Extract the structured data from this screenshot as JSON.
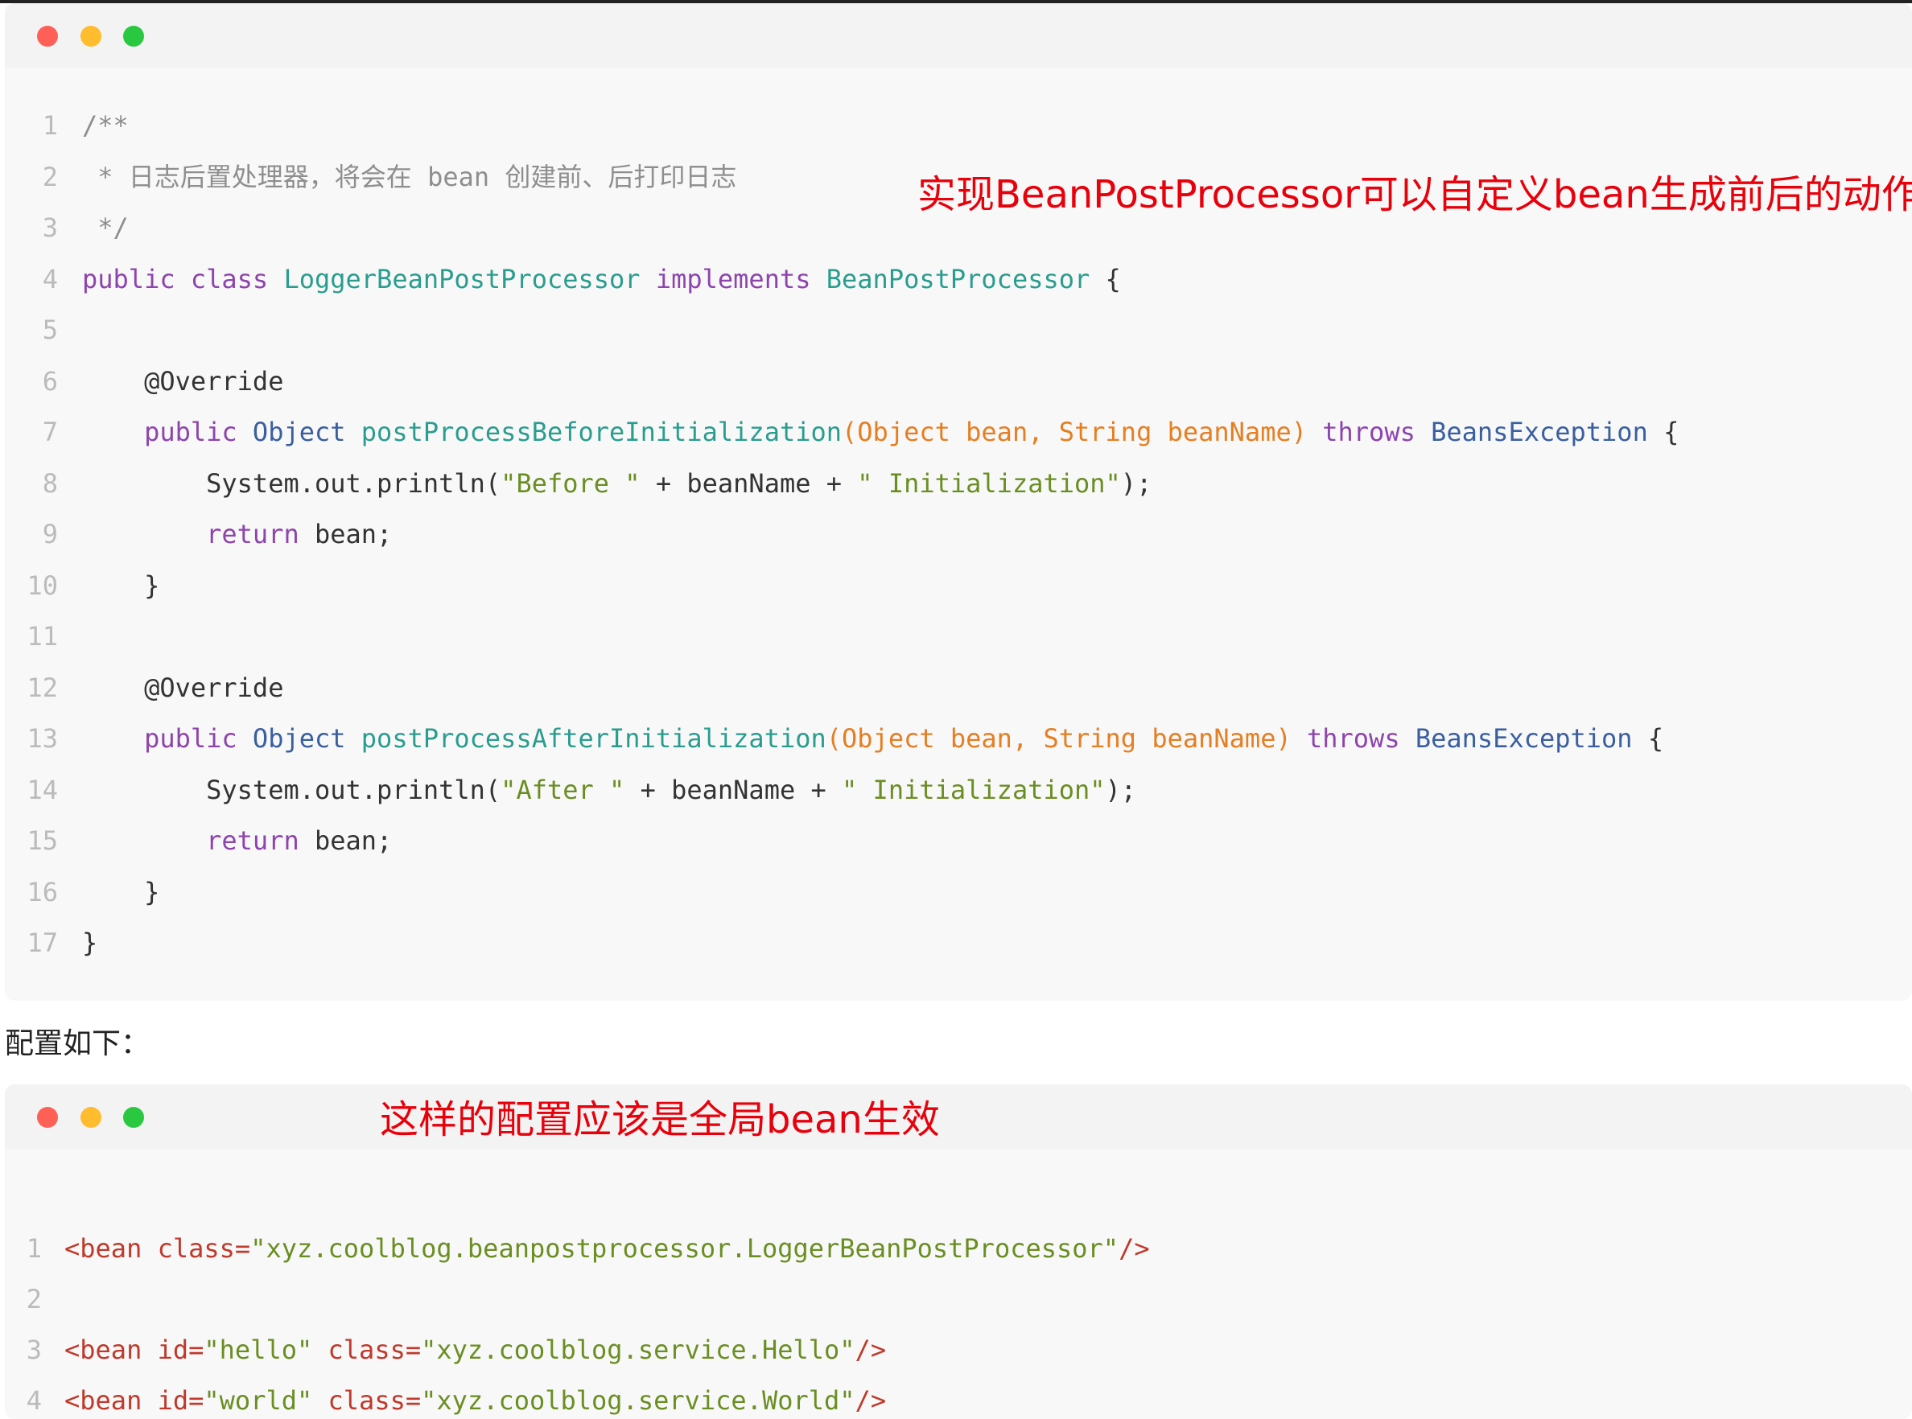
{
  "annotations": {
    "top": "实现BeanPostProcessor可以自定义bean生成前后的动作",
    "bottom": "这样的配置应该是全局bean生效"
  },
  "paragraph": "配置如下：",
  "java_code": {
    "lines": [
      {
        "n": "1",
        "t": "/**"
      },
      {
        "n": "2",
        "t": " * 日志后置处理器，将会在 bean 创建前、后打印日志"
      },
      {
        "n": "3",
        "t": " */"
      },
      {
        "n": "4",
        "t": "public class LoggerBeanPostProcessor implements BeanPostProcessor {"
      },
      {
        "n": "5",
        "t": ""
      },
      {
        "n": "6",
        "t": "    @Override"
      },
      {
        "n": "7",
        "t": "    public Object postProcessBeforeInitialization(Object bean, String beanName) throws BeansException {"
      },
      {
        "n": "8",
        "t": "        System.out.println(\"Before \" + beanName + \" Initialization\");"
      },
      {
        "n": "9",
        "t": "        return bean;"
      },
      {
        "n": "10",
        "t": "    }"
      },
      {
        "n": "11",
        "t": ""
      },
      {
        "n": "12",
        "t": "    @Override"
      },
      {
        "n": "13",
        "t": "    public Object postProcessAfterInitialization(Object bean, String beanName) throws BeansException {"
      },
      {
        "n": "14",
        "t": "        System.out.println(\"After \" + beanName + \" Initialization\");"
      },
      {
        "n": "15",
        "t": "        return bean;"
      },
      {
        "n": "16",
        "t": "    }"
      },
      {
        "n": "17",
        "t": "}"
      }
    ]
  },
  "xml_code": {
    "lines": [
      {
        "n": "1",
        "t": "<bean class=\"xyz.coolblog.beanpostprocessor.LoggerBeanPostProcessor\"/>"
      },
      {
        "n": "2",
        "t": ""
      },
      {
        "n": "3",
        "t": "<bean id=\"hello\" class=\"xyz.coolblog.service.Hello\"/>"
      },
      {
        "n": "4",
        "t": "<bean id=\"world\" class=\"xyz.coolblog.service.World\"/>"
      }
    ]
  },
  "colors": {
    "keyword": "#8e44ad",
    "class_name": "#2a9d8f",
    "type": "#3a5fa0",
    "parameter": "#e67e22",
    "string": "#6b8e23",
    "comment": "#8e8e8e",
    "xml_tag": "#c0392b",
    "annotation": "#e8000b"
  }
}
